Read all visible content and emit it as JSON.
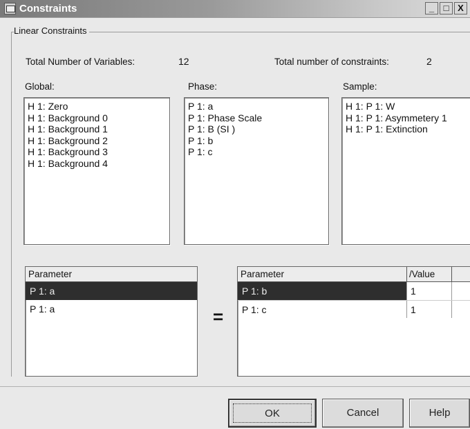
{
  "window": {
    "title": "Constraints",
    "controls": {
      "minimize": "_",
      "maximize": "□",
      "close": "X"
    }
  },
  "group": {
    "title": "Linear Constraints"
  },
  "summary": {
    "variables_label": "Total Number of Variables:",
    "variables_value": "12",
    "constraints_label": "Total number of constraints:",
    "constraints_value": "2"
  },
  "lists": {
    "global": {
      "label": "Global:",
      "items": [
        "H  1: Zero",
        "H  1: Background 0",
        "H  1: Background 1",
        "H  1: Background 2",
        "H  1: Background 3",
        "H  1: Background 4"
      ]
    },
    "phase": {
      "label": "Phase:",
      "items": [
        "P  1: a",
        "P  1: Phase Scale",
        "P  1: B (SI  )",
        "P  1: b",
        "P  1: c"
      ]
    },
    "sample": {
      "label": "Sample:",
      "items": [
        "H  1: P  1: W",
        "H  1: P  1: Asymmetery 1",
        "H  1: P  1: Extinction"
      ]
    }
  },
  "left_grid": {
    "header": "Parameter",
    "rows": [
      {
        "parameter": "P  1: a",
        "selected": true
      },
      {
        "parameter": "P  1: a",
        "selected": false
      }
    ]
  },
  "equals_sign": "=",
  "right_grid": {
    "header_parameter": "Parameter",
    "header_value": "/Value",
    "rows": [
      {
        "parameter": "P  1: b",
        "value": "1",
        "selected": true
      },
      {
        "parameter": "P  1: c",
        "value": "1",
        "selected": false
      }
    ]
  },
  "buttons": {
    "ok": "OK",
    "cancel": "Cancel",
    "help": "Help"
  }
}
